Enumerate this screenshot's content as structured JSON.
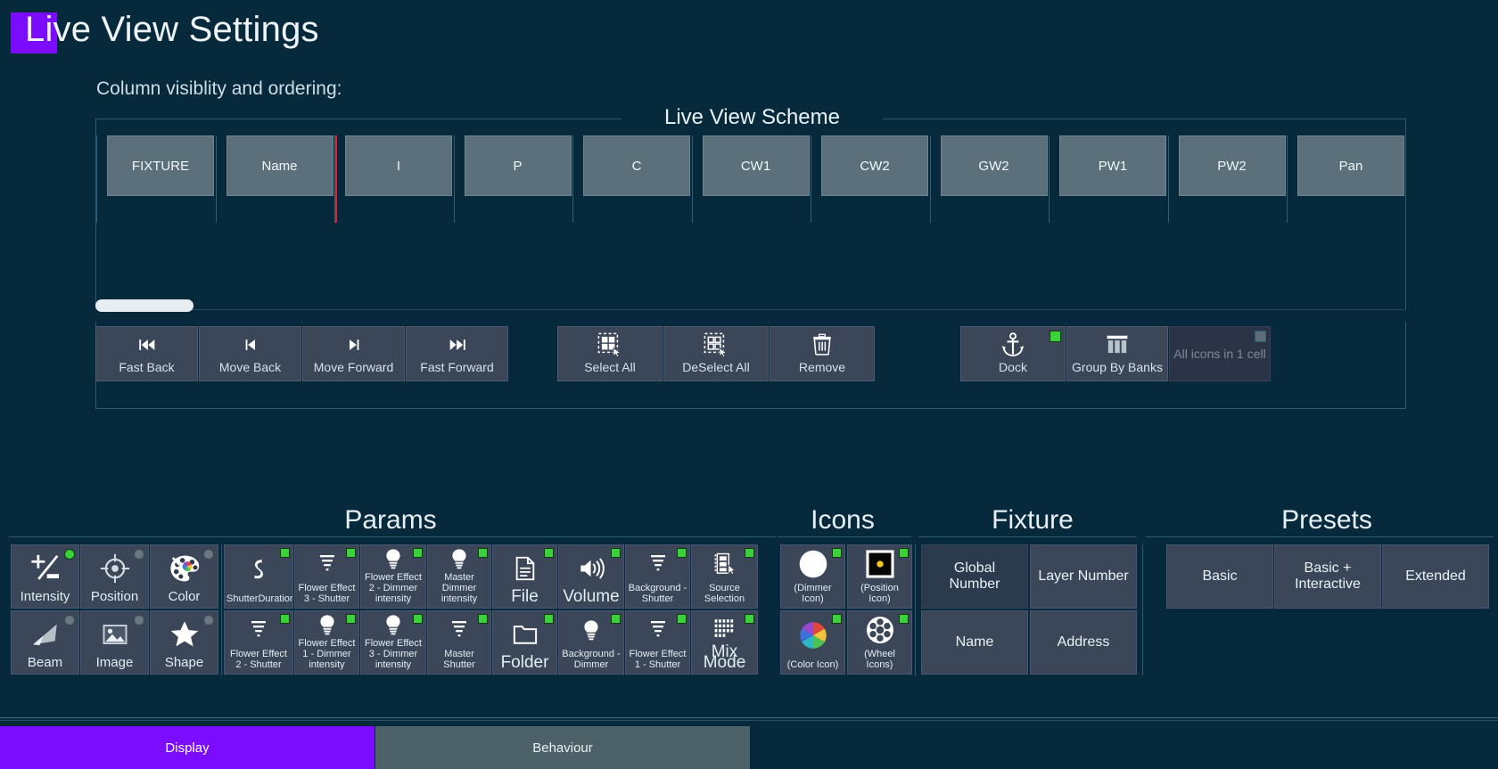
{
  "window": {
    "title": "Live View Settings",
    "accent_color": "#7c0cff",
    "background_color": "#06293c"
  },
  "columns_section": {
    "label": "Column visiblity and ordering:",
    "legend": "Live View Scheme",
    "columns": [
      {
        "label": "FIXTURE",
        "checked": true
      },
      {
        "label": "Name",
        "checked": true
      },
      {
        "label": "I",
        "checked": true
      },
      {
        "label": "P",
        "checked": true
      },
      {
        "label": "C",
        "checked": true
      },
      {
        "label": "CW1",
        "checked": true
      },
      {
        "label": "CW2",
        "checked": true
      },
      {
        "label": "GW2",
        "checked": true
      },
      {
        "label": "PW1",
        "checked": true
      },
      {
        "label": "PW2",
        "checked": true
      },
      {
        "label": "Pan",
        "checked": true
      }
    ],
    "scrollbar": {
      "position_percent": 0,
      "thumb_width_percent": 7
    }
  },
  "toolbar": {
    "buttons": [
      {
        "label": "Fast Back",
        "icon": "fast-back-icon",
        "state": "enabled"
      },
      {
        "label": "Move Back",
        "icon": "move-back-icon",
        "state": "enabled"
      },
      {
        "label": "Move Forward",
        "icon": "move-forward-icon",
        "state": "enabled"
      },
      {
        "label": "Fast Forward",
        "icon": "fast-forward-icon",
        "state": "enabled"
      },
      {
        "label": "Select All",
        "icon": "select-all-icon",
        "state": "enabled"
      },
      {
        "label": "DeSelect All",
        "icon": "deselect-all-icon",
        "state": "enabled"
      },
      {
        "label": "Remove",
        "icon": "trash-icon",
        "state": "enabled"
      },
      {
        "label": "Dock",
        "icon": "anchor-icon",
        "state": "enabled",
        "checkbox": "on"
      },
      {
        "label": "Group By Banks",
        "icon": "group-banks-icon",
        "state": "enabled"
      },
      {
        "label": "All icons in 1 cell",
        "icon": "none",
        "state": "disabled",
        "checkbox": "off"
      }
    ]
  },
  "groups": {
    "params": {
      "title": "Params",
      "main_tiles": [
        {
          "label": "Intensity",
          "icon": "intensity-icon",
          "indicator": "green"
        },
        {
          "label": "Position",
          "icon": "position-icon",
          "indicator": "gray"
        },
        {
          "label": "Color",
          "icon": "color-palette-icon",
          "indicator": "gray"
        },
        {
          "label": "Beam",
          "icon": "beam-icon",
          "indicator": "gray"
        },
        {
          "label": "Image",
          "icon": "image-icon",
          "indicator": "gray"
        },
        {
          "label": "Shape",
          "icon": "shape-star-icon",
          "indicator": "gray"
        }
      ],
      "list_tiles": [
        {
          "label": "ShutterDuration",
          "icon": "shutter-duration-icon",
          "indicator": "green",
          "size": "small"
        },
        {
          "label": "Flower Effect 3 - Shutter",
          "icon": "shutter-icon",
          "indicator": "green",
          "size": "small"
        },
        {
          "label": "Flower Effect 2 - Dimmer intensity",
          "icon": "bulb-icon",
          "indicator": "green",
          "size": "small"
        },
        {
          "label": "Master Dimmer intensity",
          "icon": "bulb-icon",
          "indicator": "green",
          "size": "small"
        },
        {
          "label": "File",
          "icon": "file-icon",
          "indicator": "green",
          "size": "medium"
        },
        {
          "label": "Volume",
          "icon": "volume-icon",
          "indicator": "green",
          "size": "medium"
        },
        {
          "label": "Background - Shutter",
          "icon": "shutter-icon",
          "indicator": "green",
          "size": "small"
        },
        {
          "label": "Source Selection",
          "icon": "source-selection-icon",
          "indicator": "green",
          "size": "small"
        },
        {
          "label": "Flower Effect 2 - Shutter",
          "icon": "shutter-icon",
          "indicator": "green",
          "size": "small"
        },
        {
          "label": "Flower Effect 1 - Dimmer intensity",
          "icon": "bulb-icon",
          "indicator": "green",
          "size": "small"
        },
        {
          "label": "Flower Effect 3 - Dimmer intensity",
          "icon": "bulb-icon",
          "indicator": "green",
          "size": "small"
        },
        {
          "label": "Master Shutter",
          "icon": "shutter-icon",
          "indicator": "green",
          "size": "small"
        },
        {
          "label": "Folder",
          "icon": "folder-icon",
          "indicator": "green",
          "size": "medium"
        },
        {
          "label": "Background - Dimmer",
          "icon": "bulb-icon",
          "indicator": "green",
          "size": "small"
        },
        {
          "label": "Flower Effect 1 - Shutter",
          "icon": "shutter-icon",
          "indicator": "green",
          "size": "small"
        },
        {
          "label": "Mix Mode",
          "icon": "mix-mode-icon",
          "indicator": "green",
          "size": "medium"
        }
      ]
    },
    "icons": {
      "title": "Icons",
      "tiles": [
        {
          "label": "(Dimmer Icon)",
          "icon": "dimmer-circle-icon",
          "indicator": "green"
        },
        {
          "label": "(Position Icon)",
          "icon": "position-square-icon",
          "indicator": "green"
        },
        {
          "label": "(Color Icon)",
          "icon": "color-wheel-icon",
          "indicator": "green"
        },
        {
          "label": "(Wheel Icons)",
          "icon": "gobo-wheel-icon",
          "indicator": "green"
        }
      ]
    },
    "fixture": {
      "title": "Fixture",
      "tiles": [
        {
          "label": "Global Number",
          "indicator": "gray",
          "state": "disabled"
        },
        {
          "label": "Layer Number",
          "indicator": "green",
          "state": "enabled"
        },
        {
          "label": "Name",
          "indicator": "green",
          "state": "enabled"
        },
        {
          "label": "Address",
          "indicator": "green",
          "state": "enabled"
        }
      ]
    },
    "presets": {
      "title": "Presets",
      "tiles": [
        {
          "label": "Basic"
        },
        {
          "label": "Basic + Interactive"
        },
        {
          "label": "Extended"
        }
      ]
    }
  },
  "tabs": [
    {
      "label": "Display",
      "active": true
    },
    {
      "label": "Behaviour",
      "active": false
    }
  ]
}
